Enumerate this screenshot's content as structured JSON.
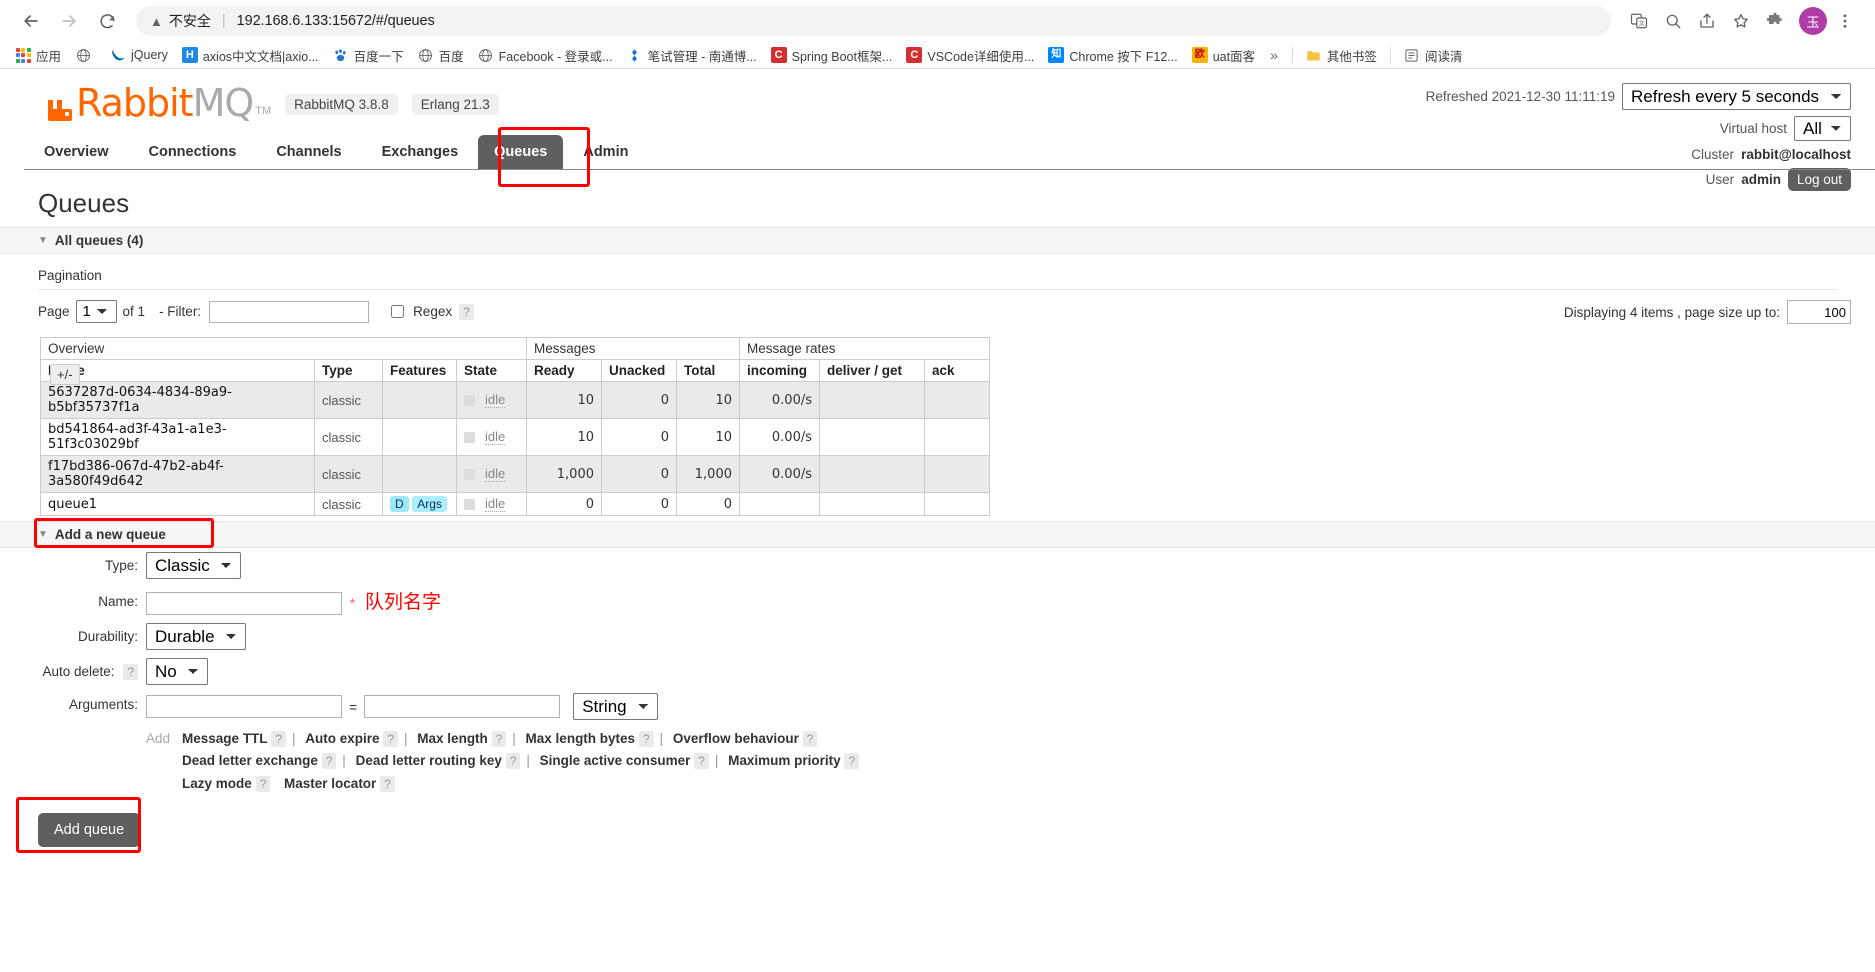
{
  "browser": {
    "back_icon": "back-arrow-icon",
    "forward_icon": "forward-arrow-icon",
    "reload_icon": "reload-icon",
    "security_warning": "不安全",
    "url": "192.168.6.133:15672/#/queues",
    "translate_icon": "translate-icon",
    "zoom_icon": "search-zoom-icon",
    "share_icon": "share-icon",
    "bookmark_icon": "star-icon",
    "extensions_icon": "puzzle-icon",
    "menu_icon": "more-vert-icon",
    "avatar_label": "玉",
    "bookmarks": [
      {
        "icon": "apps-grid-icon",
        "label": "应用"
      },
      {
        "icon": "globe-icon",
        "label": ""
      },
      {
        "icon": "jquery-icon",
        "label": "jQuery"
      },
      {
        "icon": "axios-icon",
        "label": "axios中文文档|axio..."
      },
      {
        "icon": "baidu-paw-icon",
        "label": "百度一下"
      },
      {
        "icon": "globe-icon",
        "label": "百度"
      },
      {
        "icon": "globe-icon",
        "label": "Facebook - 登录或..."
      },
      {
        "icon": "diamond-icon",
        "label": "笔试管理 - 南通博..."
      },
      {
        "icon": "csdn-icon",
        "label": "Spring Boot框架..."
      },
      {
        "icon": "csdn-icon",
        "label": "VSCode详细使用..."
      },
      {
        "icon": "zhihu-icon",
        "label": "Chrome 按下 F12..."
      },
      {
        "icon": "ou-icon",
        "label": "uat面客"
      }
    ],
    "overflow_label": "»",
    "other_bookmarks": {
      "icon": "folder-icon",
      "label": "其他书签"
    },
    "reading_list": {
      "icon": "reading-list-icon",
      "label": "阅读清"
    }
  },
  "header": {
    "product_name_orange": "Rabbit",
    "product_name_grey": "MQ",
    "trademark": "TM",
    "version_badge": "RabbitMQ 3.8.8",
    "erlang_badge": "Erlang 21.3",
    "refreshed_text": "Refreshed 2021-12-30 11:11:19",
    "refresh_select": "Refresh every 5 seconds",
    "vhost_label": "Virtual host",
    "vhost_select": "All",
    "cluster_label": "Cluster",
    "cluster_value": "rabbit@localhost",
    "user_label": "User",
    "user_value": "admin",
    "logout_label": "Log out"
  },
  "nav": {
    "tabs": [
      {
        "label": "Overview",
        "selected": false
      },
      {
        "label": "Connections",
        "selected": false
      },
      {
        "label": "Channels",
        "selected": false
      },
      {
        "label": "Exchanges",
        "selected": false
      },
      {
        "label": "Queues",
        "selected": true
      },
      {
        "label": "Admin",
        "selected": false
      }
    ]
  },
  "main": {
    "page_title": "Queues",
    "all_queues_label": "All queues (4)",
    "pagination_label": "Pagination",
    "page_label": "Page",
    "page_value": "1",
    "of_label": "of 1",
    "filter_label": "- Filter:",
    "filter_value": "",
    "regex_label": "Regex",
    "help_mark": "?",
    "displaying_text": "Displaying 4 items , page size up to:",
    "page_size_value": "100",
    "plus_minus": "+/-"
  },
  "table": {
    "group_headers": [
      "Overview",
      "Messages",
      "Message rates"
    ],
    "columns": [
      "Name",
      "Type",
      "Features",
      "State",
      "Ready",
      "Unacked",
      "Total",
      "incoming",
      "deliver / get",
      "ack"
    ],
    "rows": [
      {
        "name": "5637287d-0634-4834-89a9-b5bf35737f1a",
        "type": "classic",
        "features": [],
        "state": "idle",
        "ready": "10",
        "unacked": "0",
        "total": "10",
        "incoming": "0.00/s",
        "deliver_get": "",
        "ack": ""
      },
      {
        "name": "bd541864-ad3f-43a1-a1e3-51f3c03029bf",
        "type": "classic",
        "features": [],
        "state": "idle",
        "ready": "10",
        "unacked": "0",
        "total": "10",
        "incoming": "0.00/s",
        "deliver_get": "",
        "ack": ""
      },
      {
        "name": "f17bd386-067d-47b2-ab4f-3a580f49d642",
        "type": "classic",
        "features": [],
        "state": "idle",
        "ready": "1,000",
        "unacked": "0",
        "total": "1,000",
        "incoming": "0.00/s",
        "deliver_get": "",
        "ack": ""
      },
      {
        "name": "queue1",
        "type": "classic",
        "features": [
          "D",
          "Args"
        ],
        "state": "idle",
        "ready": "0",
        "unacked": "0",
        "total": "0",
        "incoming": "",
        "deliver_get": "",
        "ack": ""
      }
    ]
  },
  "add_queue": {
    "section_label": "Add a new queue",
    "type_label": "Type:",
    "type_value": "Classic",
    "name_label": "Name:",
    "name_value": "",
    "name_required_star": "*",
    "name_annotation": "队列名字",
    "durability_label": "Durability:",
    "durability_value": "Durable",
    "auto_delete_label": "Auto delete:",
    "auto_delete_value": "No",
    "arguments_label": "Arguments:",
    "arg_key_value": "",
    "arg_val_value": "",
    "arg_type_value": "String",
    "equals_sign": "=",
    "add_label": "Add",
    "preset_rows": [
      [
        "Message TTL",
        "Auto expire",
        "Max length",
        "Max length bytes",
        "Overflow behaviour"
      ],
      [
        "Dead letter exchange",
        "Dead letter routing key",
        "Single active consumer",
        "Maximum priority"
      ],
      [
        "Lazy mode",
        "Master locator"
      ]
    ],
    "submit_label": "Add queue"
  },
  "colors": {
    "brand_orange": "#ff6600",
    "tab_selected_bg": "#5f5f5f",
    "highlight_red": "#ff0000",
    "tag_blue": "#9fe6f7"
  }
}
